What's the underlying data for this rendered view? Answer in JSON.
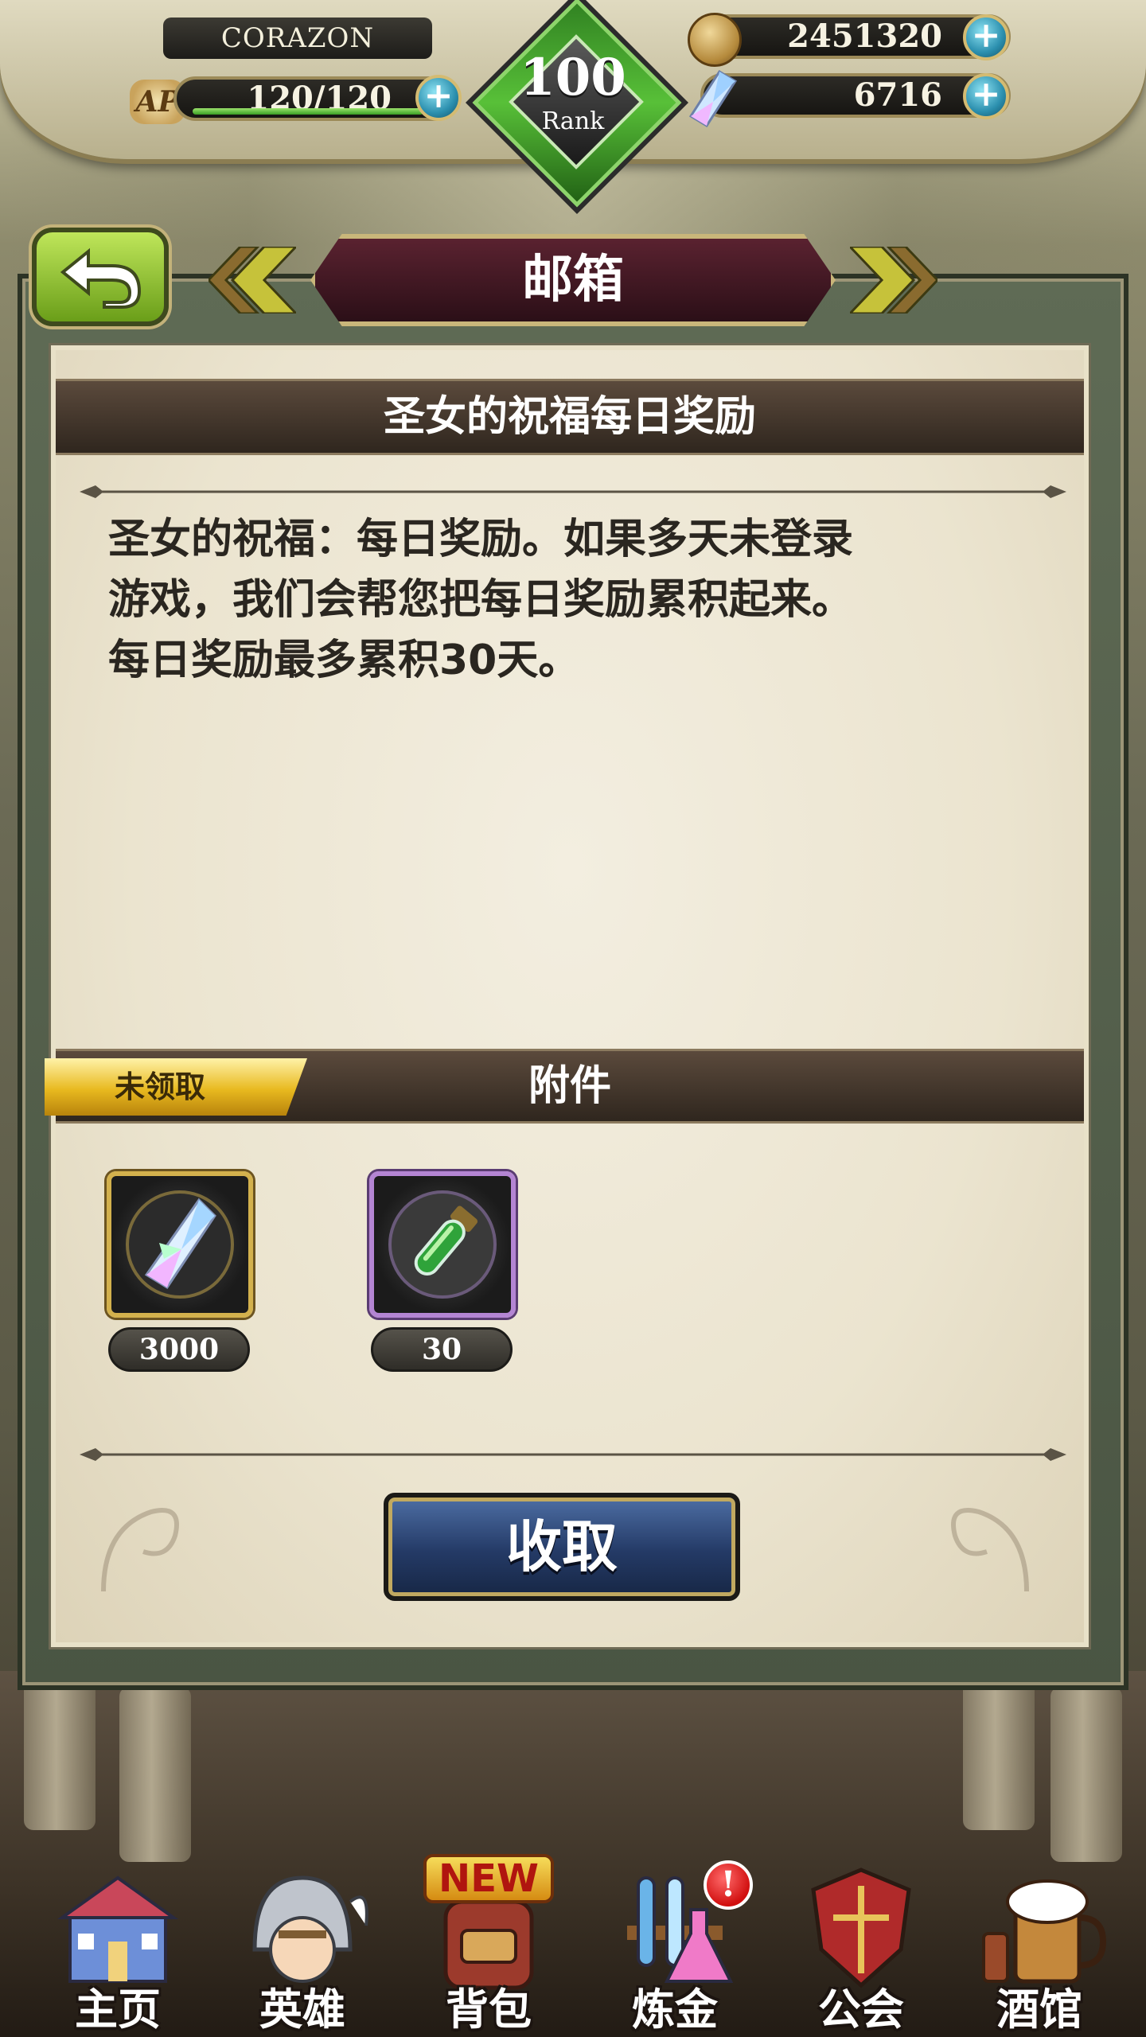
{
  "hud": {
    "player_name": "CORAZON",
    "ap_label": "AP",
    "ap_value": "120/120",
    "ap_fraction": 1.0,
    "rank_number": "100",
    "rank_label": "Rank",
    "gold": "2451320",
    "gems": "6716",
    "plus_symbol": "+"
  },
  "header": {
    "title": "邮箱",
    "back_icon": "back-arrow-icon"
  },
  "mail": {
    "subject": "圣女的祝福每日奖励",
    "body": "圣女的祝福：每日奖励。如果多天未登录\n游戏，我们会帮您把每日奖励累积起来。\n每日奖励最多累积30天。",
    "status_label": "未领取",
    "attachments_title": "附件",
    "attachments": [
      {
        "icon": "crystal-icon",
        "quantity": "3000"
      },
      {
        "icon": "green-potion-icon",
        "quantity": "30"
      }
    ],
    "claim_label": "收取"
  },
  "nav": {
    "items": [
      {
        "label": "主页",
        "icon": "castle-icon"
      },
      {
        "label": "英雄",
        "icon": "knight-helmet-icon"
      },
      {
        "label": "背包",
        "icon": "backpack-icon",
        "badge": "NEW"
      },
      {
        "label": "炼金",
        "icon": "test-tubes-icon",
        "alert": "!"
      },
      {
        "label": "公会",
        "icon": "guild-shield-icon"
      },
      {
        "label": "酒馆",
        "icon": "tavern-beer-icon"
      }
    ]
  },
  "colors": {
    "title_banner": "#3a1420",
    "claim_button": "#2b4576",
    "unclaimed_tag": "#e8b91f",
    "ap_bar_fill": "#5cc23a"
  }
}
